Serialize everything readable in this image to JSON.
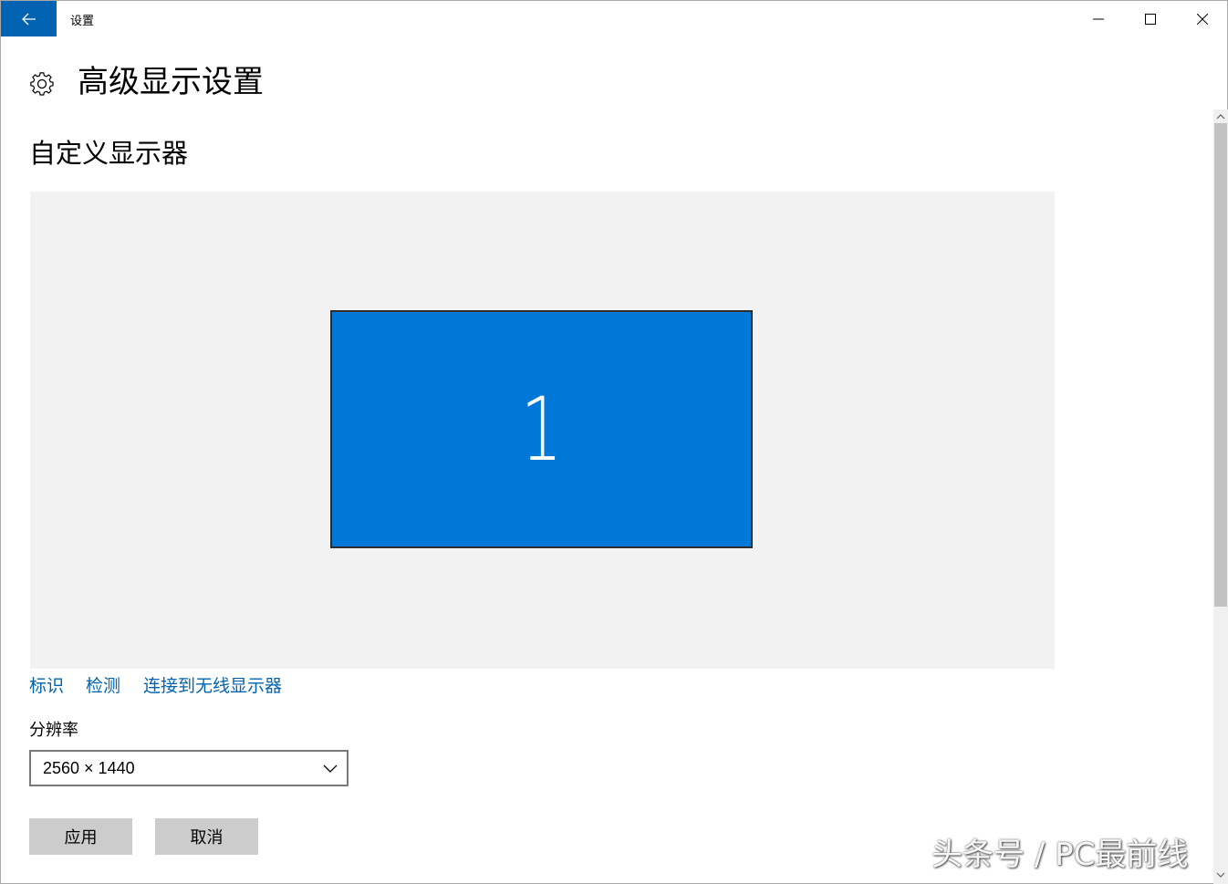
{
  "titlebar": {
    "title": "设置",
    "accent_color": "#0063b1"
  },
  "header": {
    "title": "高级显示设置",
    "icon": "gear-icon"
  },
  "section": {
    "title": "自定义显示器"
  },
  "display": {
    "monitor_number": "1",
    "monitor_color": "#0078d7",
    "area_color": "#f2f2f2"
  },
  "links": {
    "identify": "标识",
    "detect": "检测",
    "connect_wireless": "连接到无线显示器"
  },
  "resolution": {
    "label": "分辨率",
    "value": "2560 × 1440"
  },
  "buttons": {
    "apply": "应用",
    "cancel": "取消"
  },
  "watermark": {
    "text": "头条号 / PC最前线"
  }
}
